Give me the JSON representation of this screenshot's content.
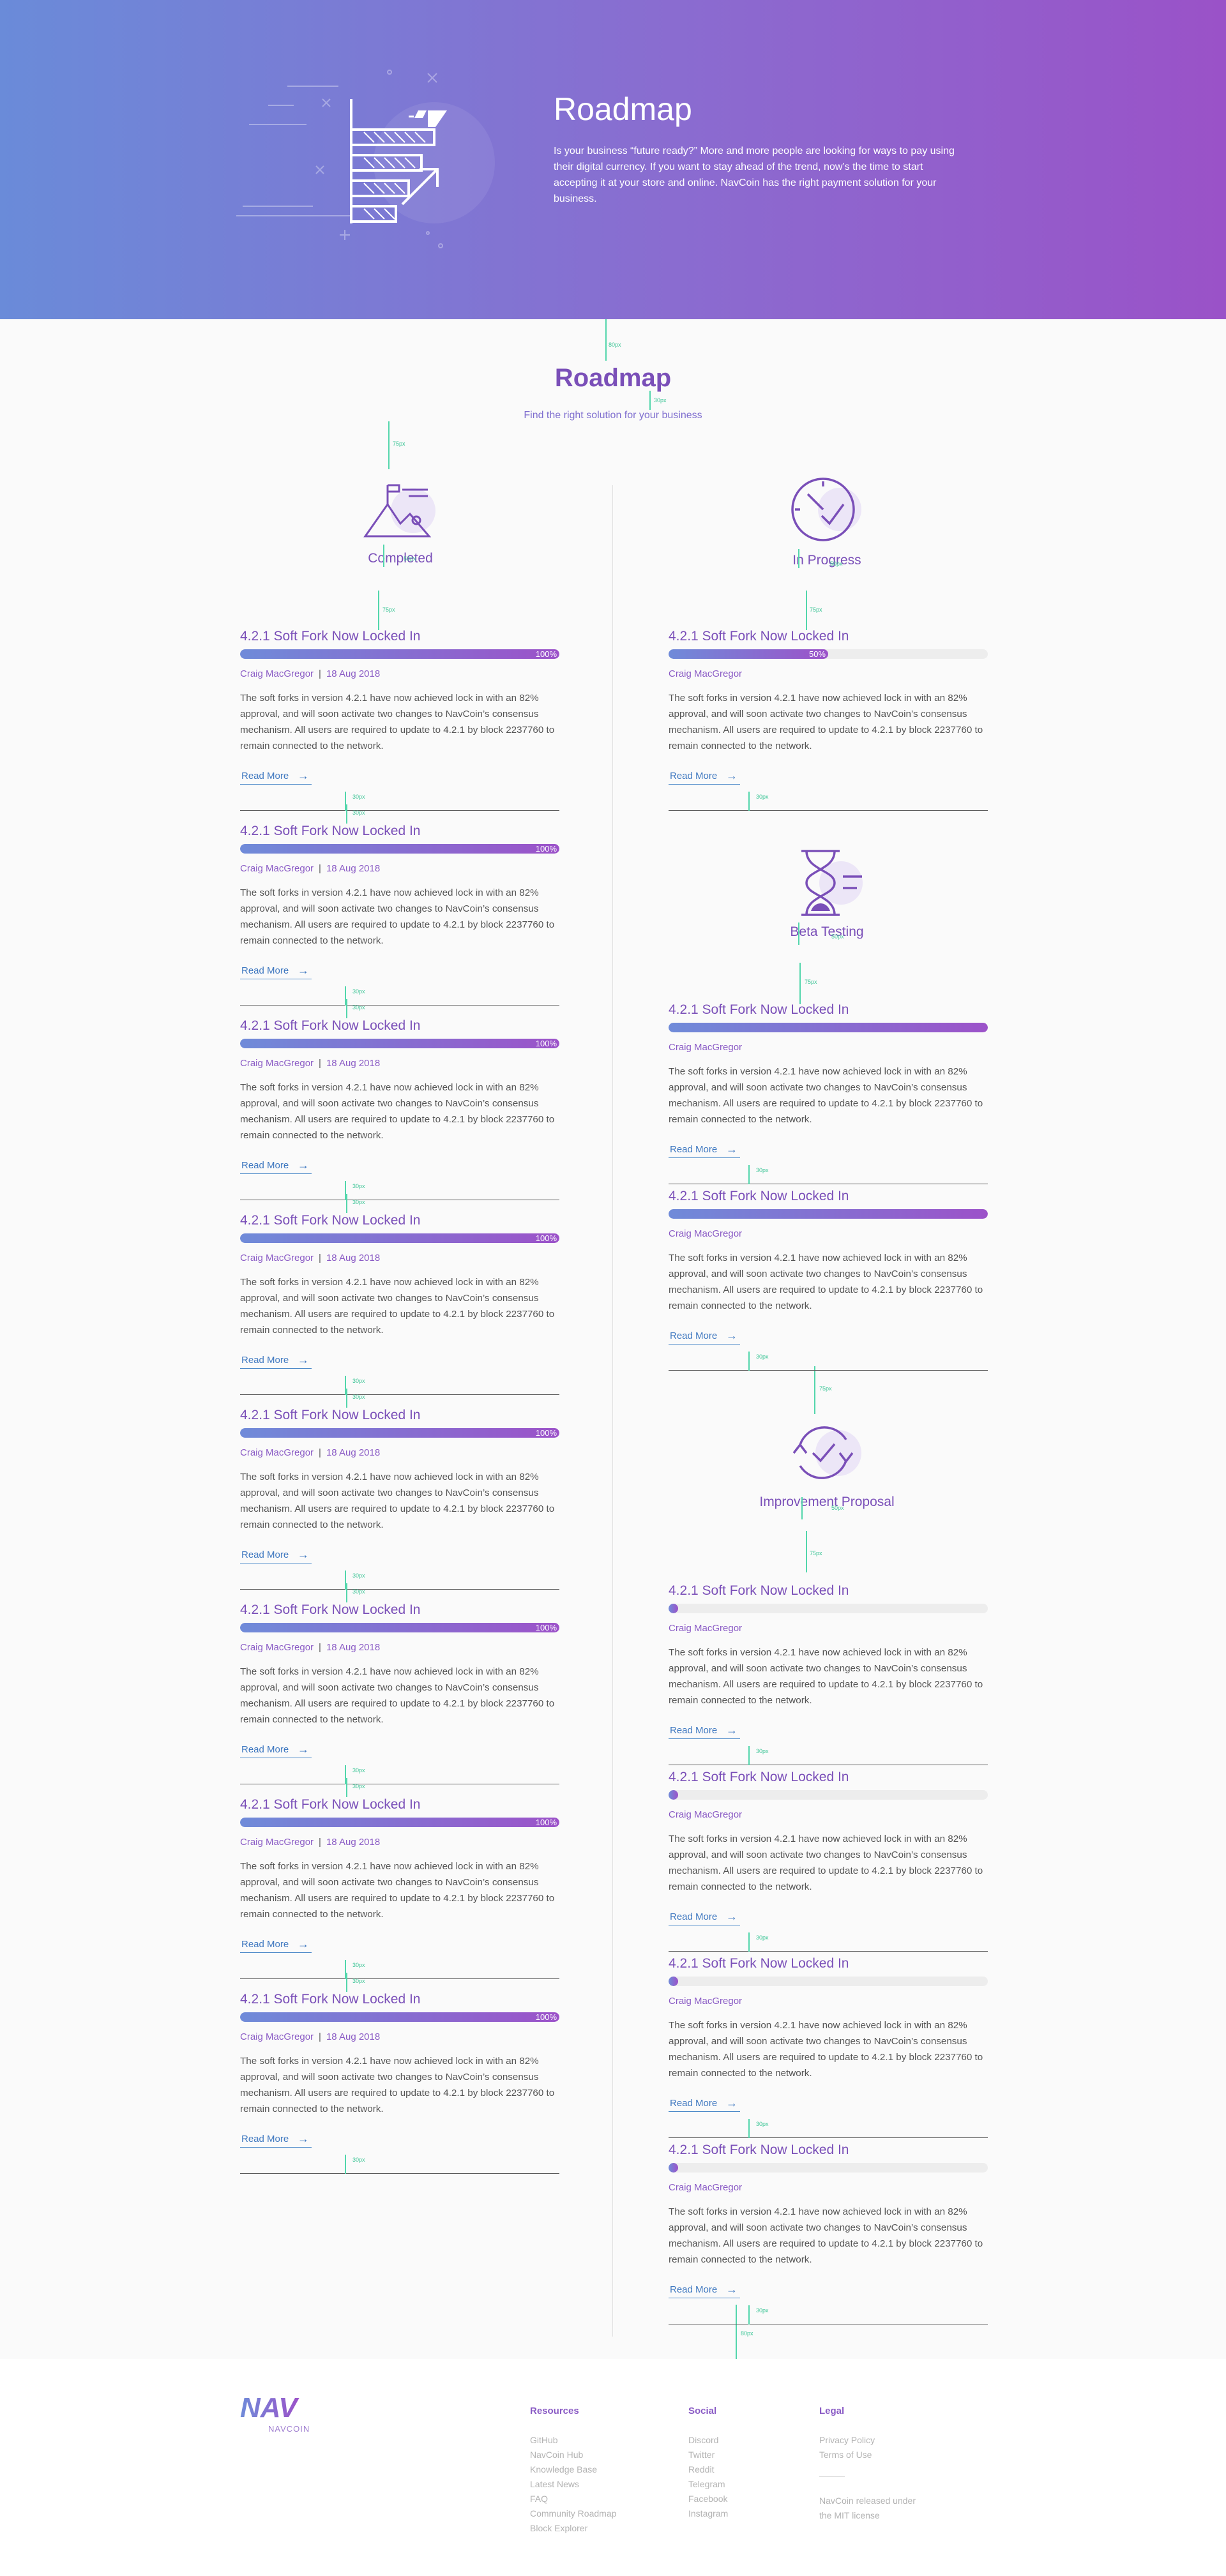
{
  "hero": {
    "title": "Roadmap",
    "text": "Is your business “future ready?” More and more people are looking for ways to pay using their digital currency. If you want to stay ahead of the trend, now’s the time to start accepting it at your store and online. NavCoin has the right payment solution for your business."
  },
  "section": {
    "title": "Roadmap",
    "subtitle": "Find the right solution for your business"
  },
  "guides": {
    "g80": "80px",
    "g30": "30px",
    "g75": "75px",
    "g50": "50px"
  },
  "categories": {
    "completed": "Completed",
    "in_progress": "In Progress",
    "beta_testing": "Beta Testing",
    "improvement": "Improvement Proposal"
  },
  "card": {
    "title": "4.2.1 Soft Fork Now Locked In",
    "author": "Craig MacGregor",
    "date": "18 Aug 2018",
    "separator": "|",
    "body": "The soft forks in version 4.2.1 have now achieved lock in with an 82% approval, and will soon activate two changes to NavCoin’s consensus mechanism. All users are required to update to 4.2.1 by block 2237760 to remain connected to the network.",
    "read_more": "Read More",
    "arrow": "→"
  },
  "progress": {
    "completed": {
      "value": 100,
      "label": "100%"
    },
    "in_progress": {
      "value": 50,
      "label": "50%"
    },
    "beta": {
      "value": 100
    },
    "proposal": {
      "value": 0
    }
  },
  "colors": {
    "accent": "#7a4fb8",
    "gradient_start": "#6f8bd9",
    "gradient_end": "#9c52c9",
    "guide": "#52d6ab",
    "link": "#3f78c0"
  },
  "footer": {
    "logo": "NAV",
    "logo_sub": "NAVCOIN",
    "resources": {
      "heading": "Resources",
      "items": [
        "GitHub",
        "NavCoin Hub",
        "Knowledge Base",
        "Latest News",
        "FAQ",
        "Community Roadmap",
        "Block Explorer"
      ]
    },
    "social": {
      "heading": "Social",
      "items": [
        "Discord",
        "Twitter",
        "Reddit",
        "Telegram",
        "Facebook",
        "Instagram"
      ]
    },
    "legal": {
      "heading": "Legal",
      "items": [
        "Privacy Policy",
        "Terms of Use"
      ],
      "note": [
        "NavCoin released under",
        "the MIT license"
      ]
    }
  }
}
